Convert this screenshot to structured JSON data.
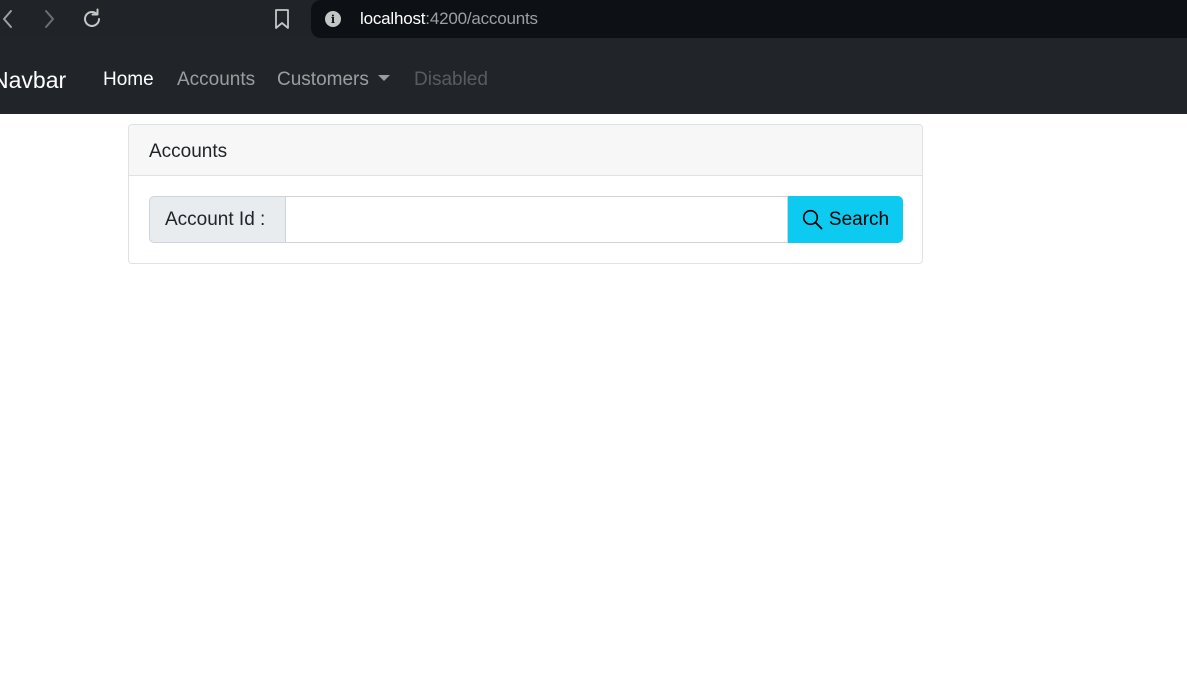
{
  "browser": {
    "url_host": "localhost",
    "url_path": ":4200/accounts",
    "icons": {
      "back": "chevron-left-icon",
      "forward": "chevron-right-icon",
      "reload": "reload-icon",
      "bookmark": "bookmark-icon",
      "site_info": "info-icon"
    }
  },
  "navbar": {
    "brand": "Navbar",
    "links": [
      {
        "label": "Home",
        "state": "active"
      },
      {
        "label": "Accounts",
        "state": "normal"
      },
      {
        "label": "Customers",
        "state": "dropdown"
      },
      {
        "label": "Disabled",
        "state": "disabled"
      }
    ]
  },
  "card": {
    "title": "Accounts",
    "search": {
      "label": "Account Id :",
      "input_value": "",
      "button_label": "Search",
      "button_icon": "search-icon"
    }
  },
  "colors": {
    "navbar_bg": "#212529",
    "search_button": "#0dcaf0",
    "browser_bar": "#202327"
  }
}
